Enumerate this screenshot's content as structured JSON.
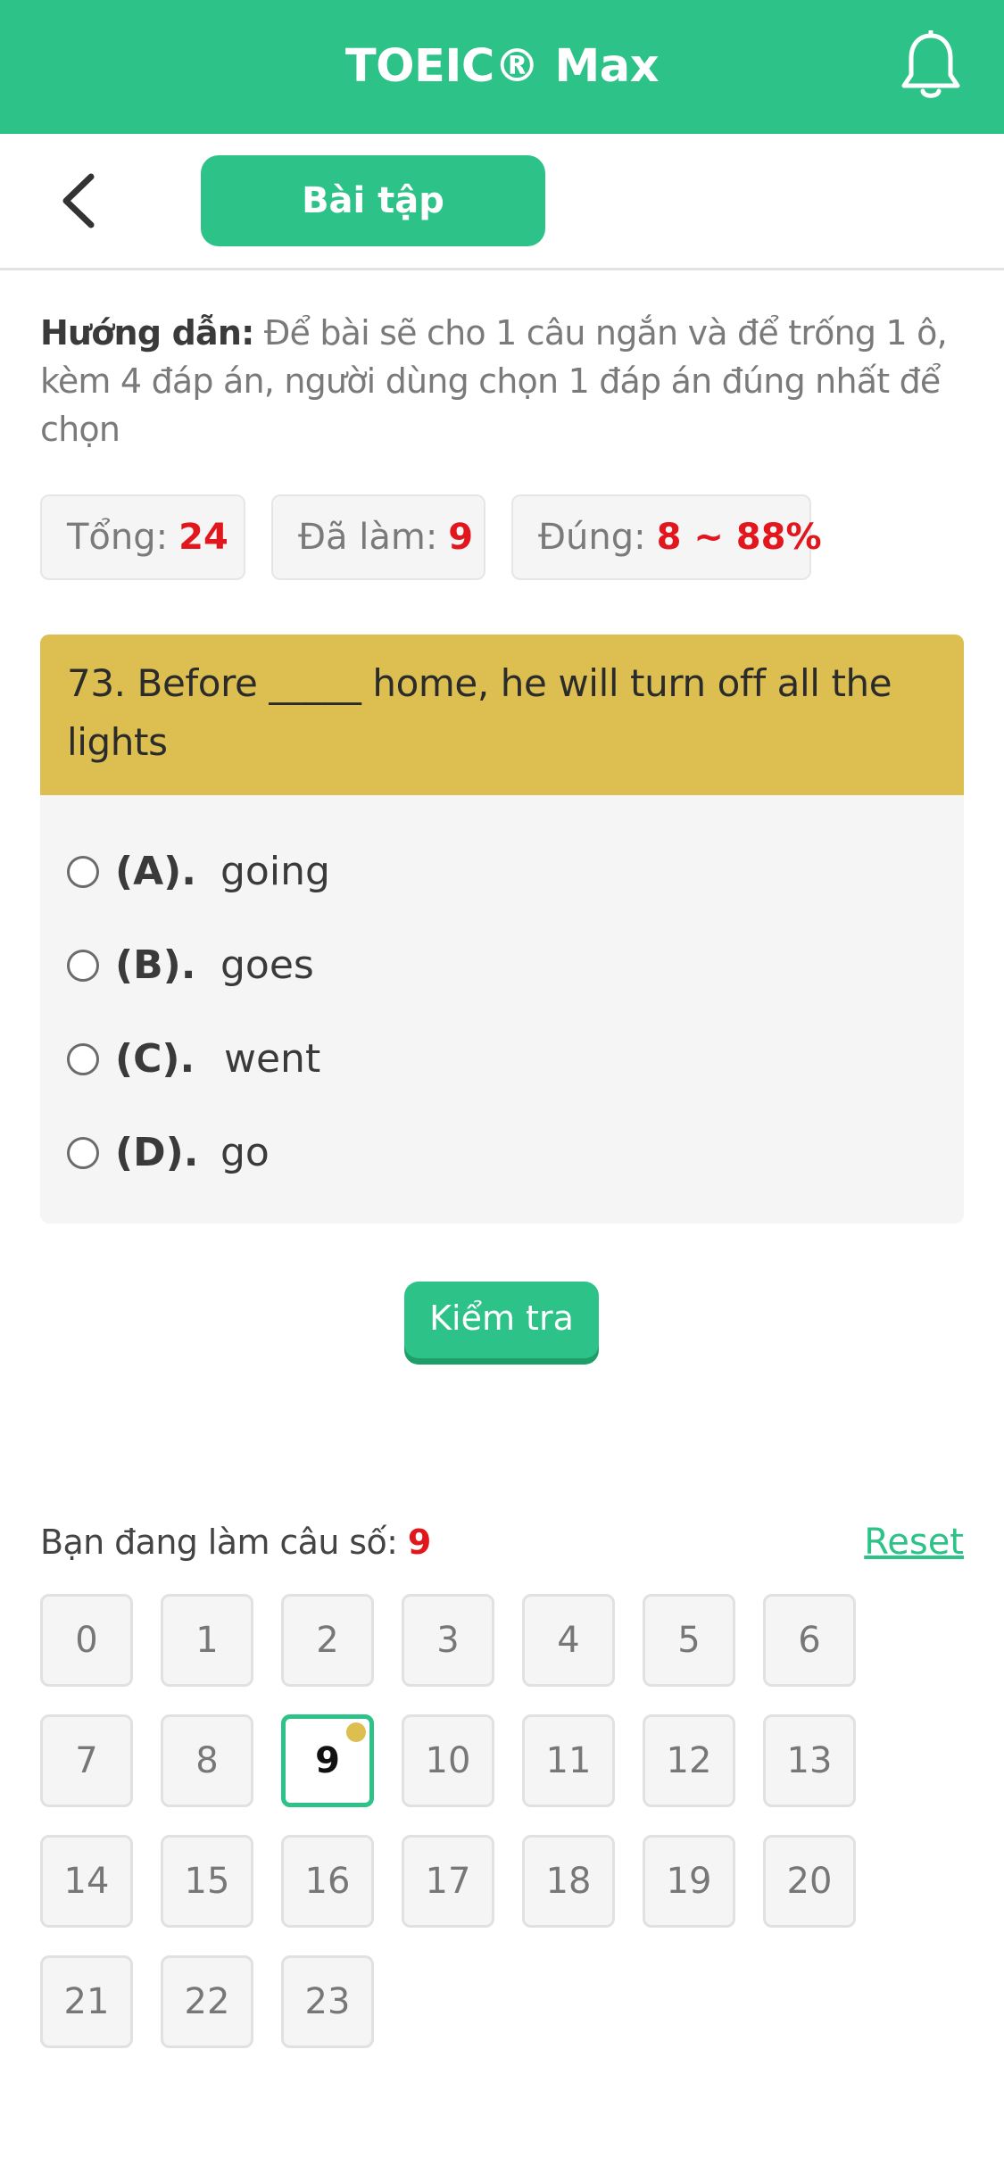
{
  "header": {
    "title": "TOEIC® Max",
    "bell_icon": "bell-icon"
  },
  "subheader": {
    "back_icon": "chevron-left-icon",
    "tab_label": "Bài tập"
  },
  "instructions": {
    "label": "Hướng dẫn:",
    "text": " Để bài sẽ cho 1 câu ngắn và để trống 1 ô, kèm 4 đáp án, người dùng chọn 1 đáp án đúng nhất để chọn"
  },
  "stats": {
    "total_label": "Tổng:",
    "total_value": "24",
    "done_label": "Đã làm:",
    "done_value": "9",
    "correct_label": "Đúng:",
    "correct_value": "8 ~ 88%"
  },
  "question": {
    "text": "73. Before _____ home, he will turn off all the lights",
    "options": [
      {
        "letter": "(A).",
        "text": "going"
      },
      {
        "letter": "(B).",
        "text": "goes"
      },
      {
        "letter": "(C).",
        "text": "went"
      },
      {
        "letter": "(D).",
        "text": "go"
      }
    ]
  },
  "check_button": "Kiểm tra",
  "progress": {
    "label": "Bạn đang làm câu số:",
    "current": "9",
    "reset_label": "Reset"
  },
  "grid": {
    "numbers": [
      "0",
      "1",
      "2",
      "3",
      "4",
      "5",
      "6",
      "7",
      "8",
      "9",
      "10",
      "11",
      "12",
      "13",
      "14",
      "15",
      "16",
      "17",
      "18",
      "19",
      "20",
      "21",
      "22",
      "23"
    ],
    "current_index": 9
  },
  "colors": {
    "brand": "#2dc287",
    "question_header": "#dcbf50",
    "highlight": "#e2171d"
  }
}
